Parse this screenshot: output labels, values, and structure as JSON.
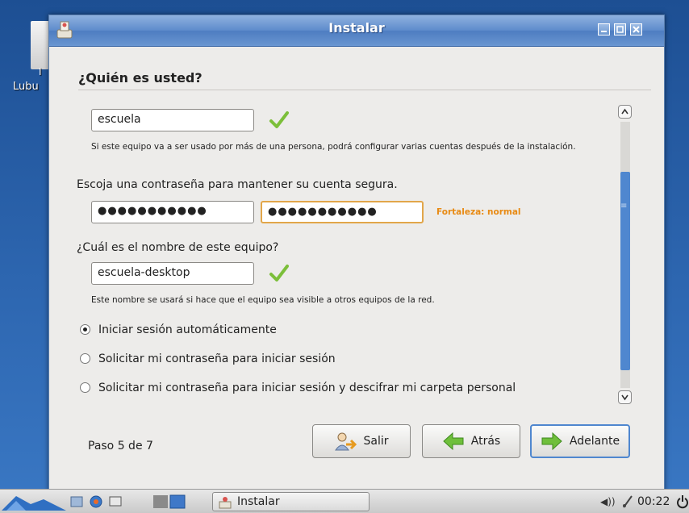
{
  "desktop": {
    "icon_label_short": "I",
    "icon_label": "Lubu"
  },
  "window": {
    "title": "Instalar",
    "heading": "¿Quién es usted?"
  },
  "form": {
    "username": "escuela",
    "username_note": "Si este equipo va a ser usado por más de una persona, podrá configurar varias cuentas después de la instalación.",
    "password_prompt": "Escoja una contraseña para mantener su cuenta segura.",
    "password_value": "●●●●●●●●●●●",
    "password_confirm_value": "●●●●●●●●●●●",
    "strength_label": "Fortaleza: normal",
    "hostname_prompt": "¿Cuál es el nombre de este equipo?",
    "hostname": "escuela-desktop",
    "hostname_note": "Este nombre se usará si hace que el equipo sea visible a otros equipos de la red.",
    "login_options": [
      {
        "label": "Iniciar sesión automáticamente",
        "selected": true
      },
      {
        "label": "Solicitar mi contraseña para iniciar sesión",
        "selected": false
      },
      {
        "label": "Solicitar mi contraseña para iniciar sesión y descifrar mi carpeta personal",
        "selected": false
      }
    ]
  },
  "footer": {
    "step": "Paso 5 de 7",
    "quit_label": "Salir",
    "back_label": "Atrás",
    "forward_label": "Adelante"
  },
  "taskbar": {
    "task_label": "Instalar",
    "clock": "00:22",
    "volume_glyph": "◀))"
  },
  "colors": {
    "strength": "#e88a13",
    "accent": "#4f87cf",
    "titlebar": "#5f8ccc"
  }
}
